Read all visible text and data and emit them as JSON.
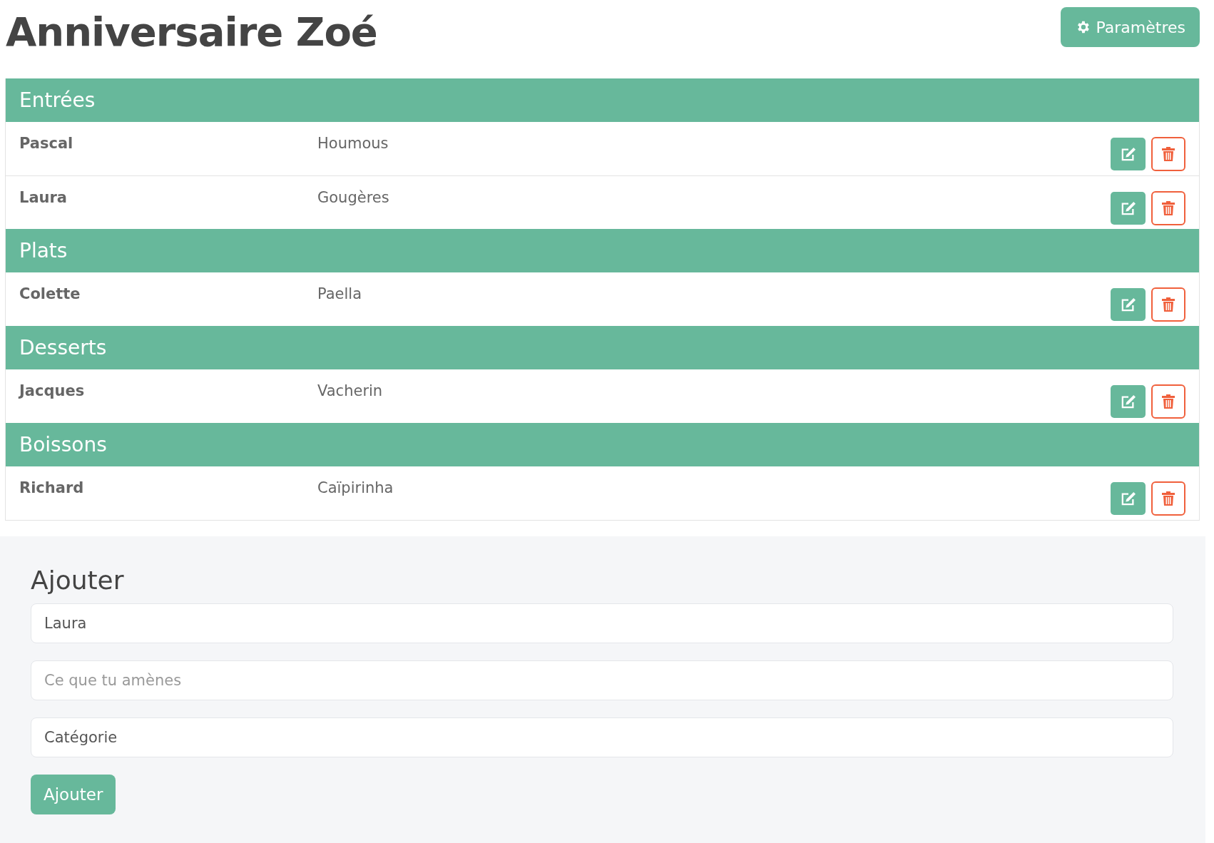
{
  "title": "Anniversaire Zoé",
  "settings_button": {
    "label": "Paramètres"
  },
  "sections": [
    {
      "name": "Entrées",
      "rows": [
        {
          "person": "Pascal",
          "dish": "Houmous"
        },
        {
          "person": "Laura",
          "dish": "Gougères"
        }
      ]
    },
    {
      "name": "Plats",
      "rows": [
        {
          "person": "Colette",
          "dish": "Paella"
        }
      ]
    },
    {
      "name": "Desserts",
      "rows": [
        {
          "person": "Jacques",
          "dish": "Vacherin"
        }
      ]
    },
    {
      "name": "Boissons",
      "rows": [
        {
          "person": "Richard",
          "dish": "Caïpirinha"
        }
      ]
    }
  ],
  "add_form": {
    "heading": "Ajouter",
    "fields": [
      {
        "value": "Laura"
      },
      {
        "placeholder": "Ce que tu amènes"
      },
      {
        "value": "Catégorie"
      }
    ],
    "submit": "Ajouter"
  }
}
